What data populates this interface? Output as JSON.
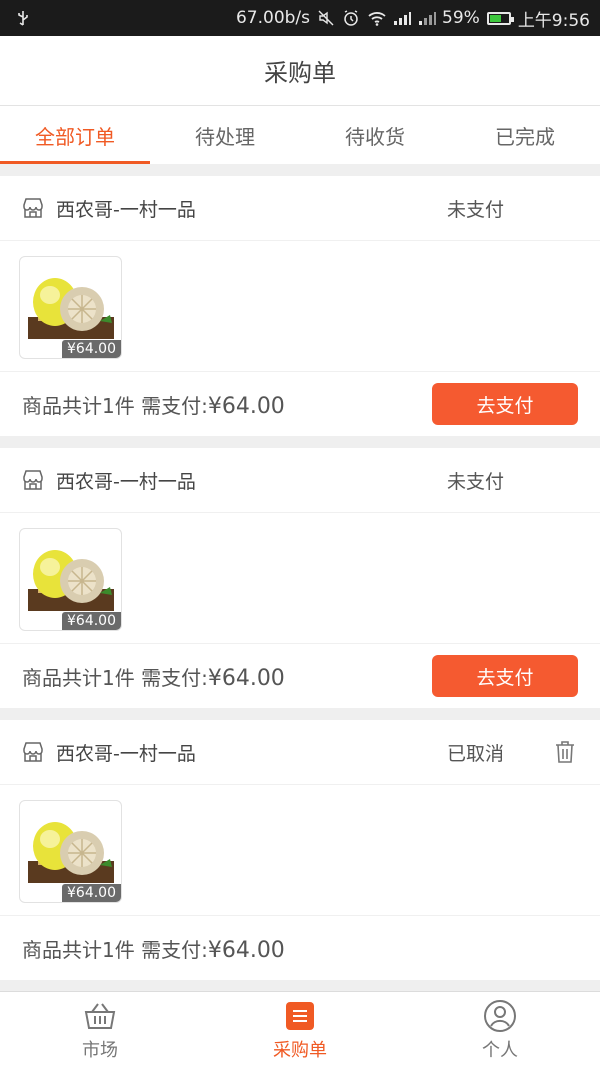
{
  "status_bar": {
    "speed": "67.00b/s",
    "battery": "59%",
    "battery_level": 0.59,
    "time": "上午9:56"
  },
  "header": {
    "title": "采购单"
  },
  "tabs": [
    {
      "label": "全部订单",
      "active": true
    },
    {
      "label": "待处理",
      "active": false
    },
    {
      "label": "待收货",
      "active": false
    },
    {
      "label": "已完成",
      "active": false
    }
  ],
  "orders": [
    {
      "shop": "西农哥-一村一品",
      "status": "未支付",
      "price_tag": "¥64.00",
      "summary_prefix": "商品共计1件 需支付:",
      "amount": "¥64.00",
      "action": "去支付"
    },
    {
      "shop": "西农哥-一村一品",
      "status": "未支付",
      "price_tag": "¥64.00",
      "summary_prefix": "商品共计1件 需支付:",
      "amount": "¥64.00",
      "action": "去支付"
    },
    {
      "shop": "西农哥-一村一品",
      "status": "已取消",
      "price_tag": "¥64.00",
      "summary_prefix": "商品共计1件 需支付:",
      "amount": "¥64.00"
    }
  ],
  "bottom_nav": [
    {
      "label": "市场",
      "icon": "basket-icon",
      "active": false
    },
    {
      "label": "采购单",
      "icon": "list-icon",
      "active": true
    },
    {
      "label": "个人",
      "icon": "person-icon",
      "active": false
    }
  ],
  "colors": {
    "accent": "#f05a24",
    "button": "#f55a30"
  }
}
